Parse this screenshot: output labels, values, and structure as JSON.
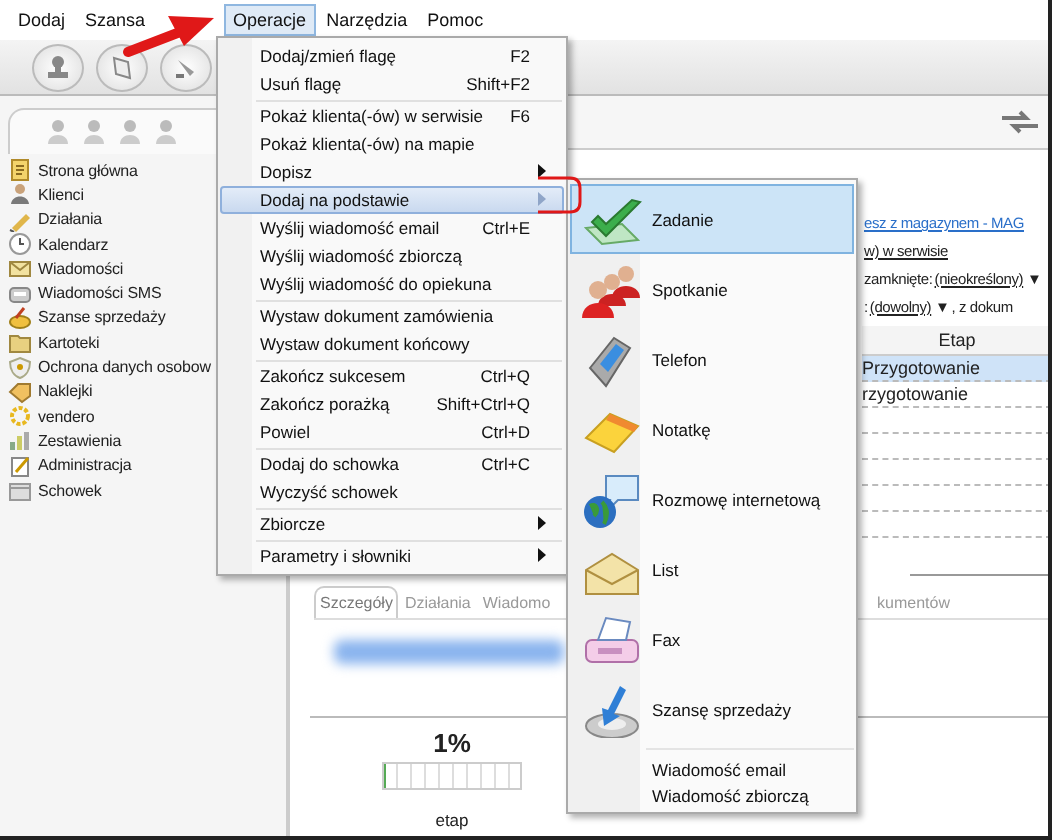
{
  "menu_bar": [
    {
      "label": "Dodaj",
      "selected": false
    },
    {
      "label": "Szansa",
      "selected": false
    },
    {
      "label": "Operacje",
      "selected": true
    },
    {
      "label": "Narzędzia",
      "selected": false
    },
    {
      "label": "Pomoc",
      "selected": false
    }
  ],
  "sidebar": {
    "items": [
      {
        "label": "Strona główna"
      },
      {
        "label": "Klienci"
      },
      {
        "label": "Działania"
      },
      {
        "label": "Kalendarz"
      },
      {
        "label": "Wiadomości"
      },
      {
        "label": "Wiadomości SMS"
      },
      {
        "label": "Szanse sprzedaży"
      },
      {
        "label": "Kartoteki"
      },
      {
        "label": "Ochrona danych osobow"
      },
      {
        "label": "Naklejki"
      },
      {
        "label": "vendero"
      },
      {
        "label": "Zestawienia"
      },
      {
        "label": "Administracja"
      },
      {
        "label": "Schowek"
      }
    ]
  },
  "main": {
    "filters": [
      {
        "kind": "link",
        "text": "esz z magazynem - MAG"
      },
      {
        "kind": "link",
        "text": "w) w serwisie"
      },
      {
        "kind": "dropdown",
        "label": "zamknięte:",
        "value": "(nieokreślony)",
        "caret": "▼"
      },
      {
        "kind": "dropdown",
        "label": ":",
        "value": "(dowolny)",
        "caret": "▼",
        "suffix": ", z dokum"
      }
    ],
    "table": {
      "columns": [
        "Etap"
      ],
      "rows": [
        {
          "cells": [
            "Przygotowanie"
          ],
          "selected": true
        },
        {
          "cells": [
            "rzygotowanie"
          ],
          "selected": false
        }
      ]
    },
    "tabs": [
      {
        "label": "Szczegóły",
        "selected": true
      },
      {
        "label": "Działania",
        "selected": false
      },
      {
        "label": "Wiadomo",
        "selected": false
      },
      {
        "label": "kumentów",
        "selected": false
      }
    ],
    "progress": {
      "reading": "1%",
      "level": 0.01,
      "caption": "etap"
    }
  },
  "operations_menu": {
    "groups": [
      [
        {
          "label": "Dodaj/zmień flagę",
          "shortcut": "F2",
          "has_submenu": false,
          "selected": false
        },
        {
          "label": "Usuń flagę",
          "shortcut": "Shift+F2",
          "has_submenu": false,
          "selected": false
        }
      ],
      [
        {
          "label": "Pokaż klienta(-ów) w serwisie",
          "shortcut": "F6",
          "has_submenu": false,
          "selected": false
        },
        {
          "label": "Pokaż klienta(-ów) na mapie",
          "has_submenu": false,
          "selected": false
        },
        {
          "label": "Dopisz",
          "has_submenu": true,
          "selected": false
        },
        {
          "label": "Dodaj na podstawie",
          "has_submenu": true,
          "selected": true
        },
        {
          "label": "Wyślij wiadomość email",
          "shortcut": "Ctrl+E",
          "has_submenu": false,
          "selected": false
        },
        {
          "label": "Wyślij wiadomość zbiorczą",
          "has_submenu": false,
          "selected": false
        },
        {
          "label": "Wyślij wiadomość do opiekuna",
          "has_submenu": false,
          "selected": false
        }
      ],
      [
        {
          "label": "Wystaw dokument zamówienia",
          "has_submenu": false,
          "selected": false
        },
        {
          "label": "Wystaw dokument końcowy",
          "has_submenu": false,
          "selected": false
        }
      ],
      [
        {
          "label": "Zakończ sukcesem",
          "shortcut": "Ctrl+Q",
          "has_submenu": false,
          "selected": false
        },
        {
          "label": "Zakończ porażką",
          "shortcut": "Shift+Ctrl+Q",
          "has_submenu": false,
          "selected": false
        },
        {
          "label": "Powiel",
          "shortcut": "Ctrl+D",
          "has_submenu": false,
          "selected": false
        }
      ],
      [
        {
          "label": "Dodaj do schowka",
          "shortcut": "Ctrl+C",
          "has_submenu": false,
          "selected": false
        },
        {
          "label": "Wyczyść schowek",
          "has_submenu": false,
          "selected": false
        }
      ],
      [
        {
          "label": "Zbiorcze",
          "has_submenu": true,
          "selected": false
        }
      ],
      [
        {
          "label": "Parametry i słowniki",
          "has_submenu": true,
          "selected": false
        }
      ]
    ]
  },
  "add_based_on_menu": {
    "items": [
      {
        "kind": "large",
        "label": "Zadanie",
        "selected": true
      },
      {
        "kind": "large",
        "label": "Spotkanie",
        "selected": false
      },
      {
        "kind": "large",
        "label": "Telefon",
        "selected": false
      },
      {
        "kind": "large",
        "label": "Notatkę",
        "selected": false
      },
      {
        "kind": "large",
        "label": "Rozmowę internetową",
        "selected": false
      },
      {
        "kind": "large",
        "label": "List",
        "selected": false
      },
      {
        "kind": "large",
        "label": "Fax",
        "selected": false
      },
      {
        "kind": "large",
        "label": "Szansę sprzedaży",
        "selected": false
      },
      {
        "kind": "small",
        "label": "Wiadomość email",
        "selected": false
      },
      {
        "kind": "small",
        "label": "Wiadomość zbiorczą",
        "selected": false
      }
    ]
  }
}
